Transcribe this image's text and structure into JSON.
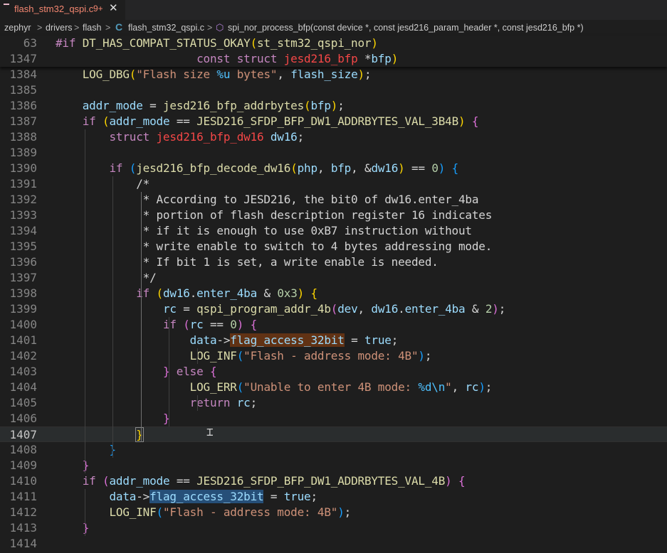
{
  "tab": {
    "filename": "flash_stm32_qspi.c",
    "problems": "9+",
    "close_icon": "✕"
  },
  "breadcrumb": {
    "items": [
      "zephyr",
      "drivers",
      "flash",
      "flash_stm32_qspi.c",
      "spi_nor_process_bfp(const device *, const jesd216_param_header *, const jesd216_bfp *)"
    ],
    "separator": ">"
  },
  "editor": {
    "sticky_lines": [
      {
        "ln": "63",
        "tokens": [
          [
            "kw",
            "#if "
          ],
          [
            "macro",
            "DT_HAS_COMPAT_STATUS_OKAY"
          ],
          [
            "b1",
            "("
          ],
          [
            "macro",
            "st_stm32_qspi_nor"
          ],
          [
            "b1",
            ")"
          ]
        ]
      },
      {
        "ln": "1347",
        "tokens": [
          [
            "op",
            "                     "
          ],
          [
            "kwt",
            "const struct "
          ],
          [
            "type",
            "jesd216_bfp "
          ],
          [
            "op",
            "*"
          ],
          [
            "var",
            "bfp"
          ],
          [
            "b1",
            ")"
          ]
        ]
      }
    ],
    "lines": [
      {
        "ln": "1384",
        "tokens": [
          [
            "op",
            "    "
          ],
          [
            "fn",
            "LOG_DBG"
          ],
          [
            "b1",
            "("
          ],
          [
            "str",
            "\"Flash size "
          ],
          [
            "macroC",
            "%u"
          ],
          [
            "str",
            " bytes\""
          ],
          [
            "op",
            ", "
          ],
          [
            "var",
            "flash_size"
          ],
          [
            "b1",
            ")"
          ],
          [
            "op",
            ";"
          ]
        ]
      },
      {
        "ln": "1385",
        "tokens": []
      },
      {
        "ln": "1386",
        "tokens": [
          [
            "op",
            "    "
          ],
          [
            "var",
            "addr_mode"
          ],
          [
            "op",
            " = "
          ],
          [
            "fn",
            "jesd216_bfp_addrbytes"
          ],
          [
            "b1",
            "("
          ],
          [
            "var",
            "bfp"
          ],
          [
            "b1",
            ")"
          ],
          [
            "op",
            ";"
          ]
        ]
      },
      {
        "ln": "1387",
        "tokens": [
          [
            "op",
            "    "
          ],
          [
            "kw",
            "if "
          ],
          [
            "b1",
            "("
          ],
          [
            "var",
            "addr_mode"
          ],
          [
            "op",
            " == "
          ],
          [
            "macro",
            "JESD216_SFDP_BFP_DW1_ADDRBYTES_VAL_3B4B"
          ],
          [
            "b1",
            ")"
          ],
          [
            "op",
            " "
          ],
          [
            "b2",
            "{"
          ]
        ]
      },
      {
        "ln": "1388",
        "tokens": [
          [
            "op",
            "        "
          ],
          [
            "kwt",
            "struct "
          ],
          [
            "type",
            "jesd216_bfp_dw16 "
          ],
          [
            "var",
            "dw16"
          ],
          [
            "op",
            ";"
          ]
        ]
      },
      {
        "ln": "1389",
        "tokens": []
      },
      {
        "ln": "1390",
        "tokens": [
          [
            "op",
            "        "
          ],
          [
            "kw",
            "if "
          ],
          [
            "b3",
            "("
          ],
          [
            "fn",
            "jesd216_bfp_decode_dw16"
          ],
          [
            "b1",
            "("
          ],
          [
            "var",
            "php"
          ],
          [
            "op",
            ", "
          ],
          [
            "var",
            "bfp"
          ],
          [
            "op",
            ", &"
          ],
          [
            "var",
            "dw16"
          ],
          [
            "b1",
            ")"
          ],
          [
            "op",
            " == "
          ],
          [
            "num",
            "0"
          ],
          [
            "b3",
            ")"
          ],
          [
            "op",
            " "
          ],
          [
            "b3",
            "{"
          ]
        ]
      },
      {
        "ln": "1391",
        "tokens": [
          [
            "op",
            "            "
          ],
          [
            "cmt",
            "/*"
          ]
        ]
      },
      {
        "ln": "1392",
        "tokens": [
          [
            "op",
            "            "
          ],
          [
            "cmt",
            " * According to JESD216, the bit0 of dw16.enter_4ba"
          ]
        ]
      },
      {
        "ln": "1393",
        "tokens": [
          [
            "op",
            "            "
          ],
          [
            "cmt",
            " * portion of flash description register 16 indicates"
          ]
        ]
      },
      {
        "ln": "1394",
        "tokens": [
          [
            "op",
            "            "
          ],
          [
            "cmt",
            " * if it is enough to use 0xB7 instruction without"
          ]
        ]
      },
      {
        "ln": "1395",
        "tokens": [
          [
            "op",
            "            "
          ],
          [
            "cmt",
            " * write enable to switch to 4 bytes addressing mode."
          ]
        ]
      },
      {
        "ln": "1396",
        "tokens": [
          [
            "op",
            "            "
          ],
          [
            "cmt",
            " * If bit 1 is set, a write enable is needed."
          ]
        ]
      },
      {
        "ln": "1397",
        "tokens": [
          [
            "op",
            "            "
          ],
          [
            "cmt",
            " */"
          ]
        ]
      },
      {
        "ln": "1398",
        "tokens": [
          [
            "op",
            "            "
          ],
          [
            "kw",
            "if "
          ],
          [
            "b1",
            "("
          ],
          [
            "var",
            "dw16"
          ],
          [
            "op",
            "."
          ],
          [
            "var",
            "enter_4ba"
          ],
          [
            "op",
            " & "
          ],
          [
            "num",
            "0x3"
          ],
          [
            "b1",
            ")"
          ],
          [
            "op",
            " "
          ],
          [
            "b1",
            "{"
          ]
        ]
      },
      {
        "ln": "1399",
        "tokens": [
          [
            "op",
            "                "
          ],
          [
            "var",
            "rc"
          ],
          [
            "op",
            " = "
          ],
          [
            "fn",
            "qspi_program_addr_4b"
          ],
          [
            "b2",
            "("
          ],
          [
            "var",
            "dev"
          ],
          [
            "op",
            ", "
          ],
          [
            "var",
            "dw16"
          ],
          [
            "op",
            "."
          ],
          [
            "var",
            "enter_4ba"
          ],
          [
            "op",
            " & "
          ],
          [
            "num",
            "2"
          ],
          [
            "b2",
            ")"
          ],
          [
            "op",
            ";"
          ]
        ]
      },
      {
        "ln": "1400",
        "tokens": [
          [
            "op",
            "                "
          ],
          [
            "kw",
            "if "
          ],
          [
            "b2",
            "("
          ],
          [
            "var",
            "rc"
          ],
          [
            "op",
            " == "
          ],
          [
            "num",
            "0"
          ],
          [
            "b2",
            ")"
          ],
          [
            "op",
            " "
          ],
          [
            "b2",
            "{"
          ]
        ]
      },
      {
        "ln": "1401",
        "tokens": [
          [
            "op",
            "                    "
          ],
          [
            "var",
            "data"
          ],
          [
            "op",
            "->"
          ],
          [
            "var hl1",
            "flag_access_32bit"
          ],
          [
            "op",
            " = "
          ],
          [
            "var",
            "true"
          ],
          [
            "op",
            ";"
          ]
        ]
      },
      {
        "ln": "1402",
        "tokens": [
          [
            "op",
            "                    "
          ],
          [
            "fn",
            "LOG_INF"
          ],
          [
            "b3",
            "("
          ],
          [
            "str",
            "\"Flash - address mode: 4B\""
          ],
          [
            "b3",
            ")"
          ],
          [
            "op",
            ";"
          ]
        ]
      },
      {
        "ln": "1403",
        "tokens": [
          [
            "op",
            "                "
          ],
          [
            "b2",
            "}"
          ],
          [
            "kw",
            " else "
          ],
          [
            "b2",
            "{"
          ]
        ]
      },
      {
        "ln": "1404",
        "tokens": [
          [
            "op",
            "                    "
          ],
          [
            "fn",
            "LOG_ERR"
          ],
          [
            "b3",
            "("
          ],
          [
            "str",
            "\"Unable to enter 4B mode: "
          ],
          [
            "macroC",
            "%d\\n"
          ],
          [
            "str",
            "\""
          ],
          [
            "op",
            ", "
          ],
          [
            "var",
            "rc"
          ],
          [
            "b3",
            ")"
          ],
          [
            "op",
            ";"
          ]
        ]
      },
      {
        "ln": "1405",
        "tokens": [
          [
            "op",
            "                    "
          ],
          [
            "kw",
            "return "
          ],
          [
            "var",
            "rc"
          ],
          [
            "op",
            ";"
          ]
        ]
      },
      {
        "ln": "1406",
        "tokens": [
          [
            "op",
            "                "
          ],
          [
            "b2",
            "}"
          ]
        ]
      },
      {
        "ln": "1407",
        "tokens": [
          [
            "op",
            "            "
          ],
          [
            "b1 cursor-box",
            "}"
          ]
        ]
      },
      {
        "ln": "1408",
        "tokens": [
          [
            "op",
            "        "
          ],
          [
            "b3",
            "}"
          ]
        ]
      },
      {
        "ln": "1409",
        "tokens": [
          [
            "op",
            "    "
          ],
          [
            "b2",
            "}"
          ]
        ]
      },
      {
        "ln": "1410",
        "tokens": [
          [
            "op",
            "    "
          ],
          [
            "kw",
            "if "
          ],
          [
            "b2",
            "("
          ],
          [
            "var",
            "addr_mode"
          ],
          [
            "op",
            " == "
          ],
          [
            "macro",
            "JESD216_SFDP_BFP_DW1_ADDRBYTES_VAL_4B"
          ],
          [
            "b2",
            ")"
          ],
          [
            "op",
            " "
          ],
          [
            "b2",
            "{"
          ]
        ]
      },
      {
        "ln": "1411",
        "tokens": [
          [
            "op",
            "        "
          ],
          [
            "var",
            "data"
          ],
          [
            "op",
            "->"
          ],
          [
            "var hl2",
            "flag_access_32bit"
          ],
          [
            "op",
            " = "
          ],
          [
            "var",
            "true"
          ],
          [
            "op",
            ";"
          ]
        ]
      },
      {
        "ln": "1412",
        "tokens": [
          [
            "op",
            "        "
          ],
          [
            "fn",
            "LOG_INF"
          ],
          [
            "b3",
            "("
          ],
          [
            "str",
            "\"Flash - address mode: 4B\""
          ],
          [
            "b3",
            ")"
          ],
          [
            "op",
            ";"
          ]
        ]
      },
      {
        "ln": "1413",
        "tokens": [
          [
            "op",
            "    "
          ],
          [
            "b2",
            "}"
          ]
        ]
      },
      {
        "ln": "1414",
        "tokens": []
      }
    ]
  },
  "colors": {
    "background": "#1e1e1e",
    "tab_modified": "#f48771",
    "c_icon": "#519aba"
  }
}
